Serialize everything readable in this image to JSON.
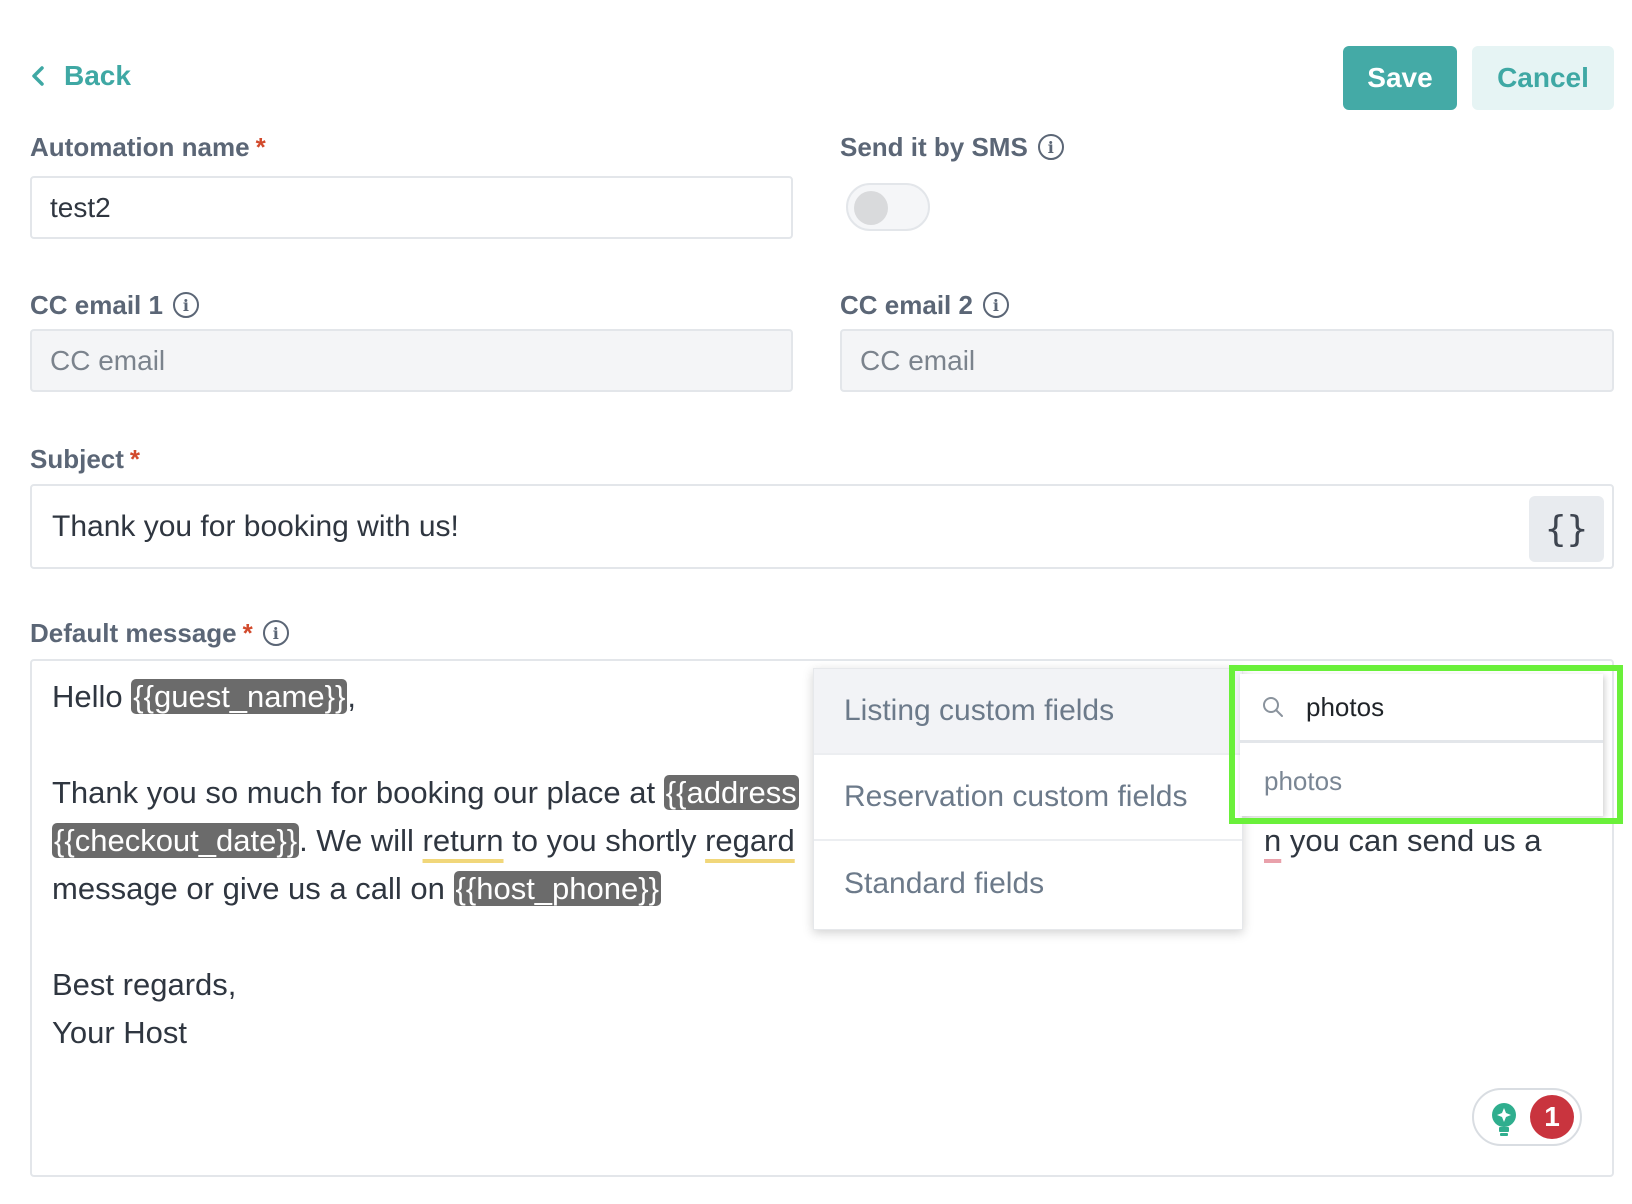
{
  "header": {
    "back_label": "Back",
    "save_label": "Save",
    "cancel_label": "Cancel"
  },
  "form": {
    "automation_name": {
      "label": "Automation name",
      "required_mark": "*",
      "value": "test2"
    },
    "send_sms": {
      "label": "Send it by SMS",
      "enabled": false
    },
    "cc_email_1": {
      "label": "CC email 1",
      "placeholder": "CC email"
    },
    "cc_email_2": {
      "label": "CC email 2",
      "placeholder": "CC email"
    },
    "subject": {
      "label": "Subject",
      "required_mark": "*",
      "value": "Thank you for booking with us!",
      "fields_button": "{}"
    },
    "default_message": {
      "label": "Default message",
      "required_mark": "*"
    }
  },
  "message": {
    "line1": {
      "t1": "Hello ",
      "tag1": "{{guest_name}}",
      "t2": ","
    },
    "line2": {
      "t1": "Thank you so much for booking our place at ",
      "tag1": "{{address"
    },
    "line3": {
      "tag1": "{{checkout_date}}",
      "t1": ". We will ",
      "w1": "return",
      "t2": " to you shortly ",
      "w2": "regard",
      "w3": "n",
      "t3": " you can send us a"
    },
    "line4": {
      "t1": "message or give us a call on ",
      "tag1": "{{host_phone}}"
    },
    "line5": "Best regards,",
    "line6": "Your Host"
  },
  "field_menu": {
    "items": [
      "Listing custom fields",
      "Reservation custom fields",
      "Standard fields"
    ],
    "active_index": 0
  },
  "field_search": {
    "query": "photos",
    "results": [
      "photos"
    ]
  },
  "grammar_widget": {
    "count": "1"
  },
  "colors": {
    "accent": "#44aaa6",
    "accent_light": "#e6f4f4",
    "required": "#d24a2c",
    "tag_bg": "#6b6b6b",
    "highlight": "#6af03a",
    "badge": "#c9343e"
  }
}
